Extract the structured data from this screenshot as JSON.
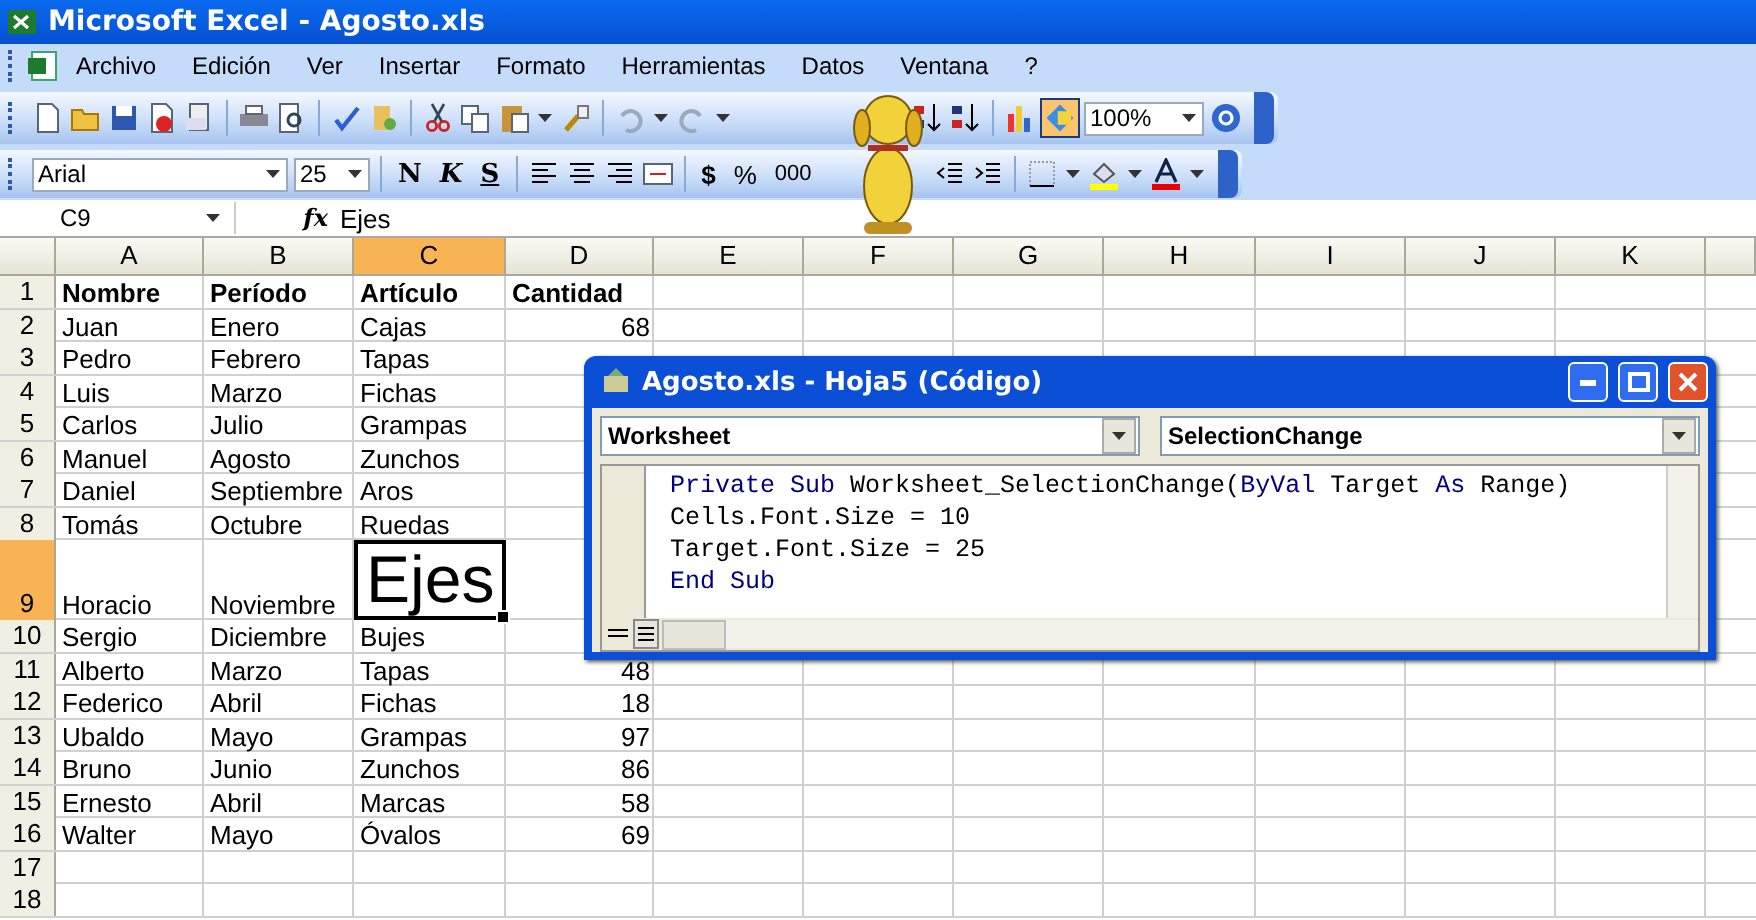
{
  "window": {
    "title": "Microsoft Excel - Agosto.xls"
  },
  "menu": [
    {
      "label": "Archivo"
    },
    {
      "label": "Edición"
    },
    {
      "label": "Ver"
    },
    {
      "label": "Insertar"
    },
    {
      "label": "Formato"
    },
    {
      "label": "Herramientas"
    },
    {
      "label": "Datos"
    },
    {
      "label": "Ventana"
    },
    {
      "label": "?"
    }
  ],
  "standard_toolbar": {
    "drawing_button": {
      "on": true
    },
    "zoom": "100%"
  },
  "formatting_toolbar": {
    "font": "Arial",
    "size": "25",
    "buttons": [
      {
        "kind": "bold",
        "label": "N"
      },
      {
        "kind": "italic",
        "label": "K"
      },
      {
        "kind": "underline",
        "label": "S"
      },
      {
        "kind": "currency",
        "label": "$"
      },
      {
        "kind": "percent",
        "label": "%"
      },
      {
        "kind": "thousands",
        "label": "000"
      }
    ]
  },
  "formula_bar": {
    "name_box": "C9",
    "fx": "fx",
    "value": "Ejes"
  },
  "sheet": {
    "columns": [
      {
        "label": "A",
        "selected": false
      },
      {
        "label": "B",
        "selected": false
      },
      {
        "label": "C",
        "selected": true
      },
      {
        "label": "D",
        "selected": false
      },
      {
        "label": "E",
        "selected": false
      },
      {
        "label": "F",
        "selected": false
      },
      {
        "label": "G",
        "selected": false
      },
      {
        "label": "H",
        "selected": false
      },
      {
        "label": "I",
        "selected": false
      },
      {
        "label": "J",
        "selected": false
      },
      {
        "label": "K",
        "selected": false
      }
    ],
    "rows": [
      {
        "label": "1",
        "selected": false,
        "kind": "header",
        "cells": [
          "Nombre",
          "Período",
          "Artículo",
          "Cantidad"
        ]
      },
      {
        "label": "2",
        "selected": false,
        "kind": "data",
        "cells": [
          "Juan",
          "Enero",
          "Cajas",
          "68"
        ]
      },
      {
        "label": "3",
        "selected": false,
        "kind": "data",
        "cells": [
          "Pedro",
          "Febrero",
          "Tapas"
        ]
      },
      {
        "label": "4",
        "selected": false,
        "kind": "data",
        "cells": [
          "Luis",
          "Marzo",
          "Fichas"
        ]
      },
      {
        "label": "5",
        "selected": false,
        "kind": "data",
        "cells": [
          "Carlos",
          "Julio",
          "Grampas"
        ]
      },
      {
        "label": "6",
        "selected": false,
        "kind": "data",
        "cells": [
          "Manuel",
          "Agosto",
          "Zunchos"
        ]
      },
      {
        "label": "7",
        "selected": false,
        "kind": "data",
        "cells": [
          "Daniel",
          "Septiembre",
          "Aros"
        ]
      },
      {
        "label": "8",
        "selected": false,
        "kind": "data",
        "cells": [
          "Tomás",
          "Octubre",
          "Ruedas"
        ]
      },
      {
        "label": "9",
        "selected": true,
        "kind": "data",
        "cells": [
          "Horacio",
          "Noviembre",
          "Ejes"
        ]
      },
      {
        "label": "10",
        "selected": false,
        "kind": "data",
        "cells": [
          "Sergio",
          "Diciembre",
          "Bujes"
        ]
      },
      {
        "label": "11",
        "selected": false,
        "kind": "data",
        "cells": [
          "Alberto",
          "Marzo",
          "Tapas",
          "48"
        ]
      },
      {
        "label": "12",
        "selected": false,
        "kind": "data",
        "cells": [
          "Federico",
          "Abril",
          "Fichas",
          "18"
        ]
      },
      {
        "label": "13",
        "selected": false,
        "kind": "data",
        "cells": [
          "Ubaldo",
          "Mayo",
          "Grampas",
          "97"
        ]
      },
      {
        "label": "14",
        "selected": false,
        "kind": "data",
        "cells": [
          "Bruno",
          "Junio",
          "Zunchos",
          "86"
        ]
      },
      {
        "label": "15",
        "selected": false,
        "kind": "data",
        "cells": [
          "Ernesto",
          "Abril",
          "Marcas",
          "58"
        ]
      },
      {
        "label": "16",
        "selected": false,
        "kind": "data",
        "cells": [
          "Walter",
          "Mayo",
          "Óvalos",
          "69"
        ]
      },
      {
        "label": "17",
        "selected": false,
        "kind": "data"
      },
      {
        "label": "18",
        "selected": false,
        "kind": "data"
      }
    ]
  },
  "code_window": {
    "title": "Agosto.xls - Hoja5 (Código)",
    "object": "Worksheet",
    "procedure": "SelectionChange",
    "lines": [
      [
        {
          "kind": "keyword",
          "text": "Private Sub "
        },
        {
          "kind": "plain",
          "text": "Worksheet_SelectionChange("
        },
        {
          "kind": "keyword",
          "text": "ByVal"
        },
        {
          "kind": "plain",
          "text": " Target "
        },
        {
          "kind": "keyword",
          "text": "As"
        },
        {
          "kind": "plain",
          "text": " Range)"
        }
      ],
      [
        {
          "kind": "plain",
          "text": "Cells.Font.Size = 10"
        }
      ],
      [
        {
          "kind": "plain",
          "text": "Target.Font.Size = 25"
        }
      ],
      [
        {
          "kind": "keyword",
          "text": "End Sub"
        }
      ]
    ]
  }
}
